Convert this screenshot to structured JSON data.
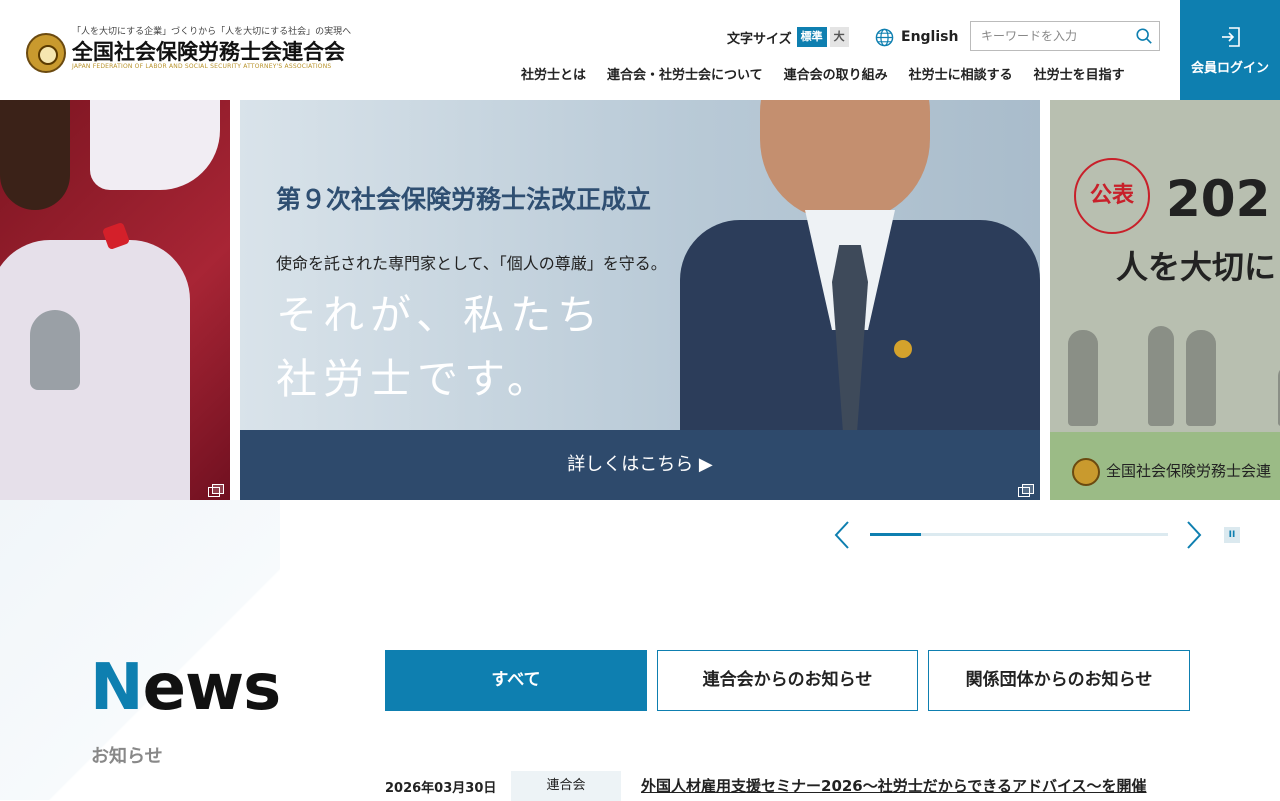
{
  "header": {
    "tagline": "「人を大切にする企業」づくりから「人を大切にする社会」の実現へ",
    "org_name": "全国社会保険労務士会連合会",
    "org_name_en": "JAPAN FEDERATION OF LABOR AND SOCIAL SECURITY ATTORNEY'S ASSOCIATIONS",
    "font_size_label": "文字サイズ",
    "font_size_standard": "標準",
    "font_size_large": "大",
    "language_label": "English",
    "search_placeholder": "キーワードを入力",
    "login_label": "会員ログイン",
    "accent_color": "#0e7fb0"
  },
  "nav": {
    "items": [
      "社労士とは",
      "連合会・社労士会について",
      "連合会の取り組み",
      "社労士に相談する",
      "社労士を目指す"
    ]
  },
  "slider": {
    "main": {
      "headline": "第９次社会保険労務士法改正成立",
      "lead": "使命を託された専門家として、「個人の尊厳」を守る。",
      "catch_line1": "それが、私たち",
      "catch_line2": "社労士です。",
      "cta": "詳しくはこちら ▶"
    },
    "right": {
      "badge": "公表",
      "year": "202",
      "subtitle": "人を大切に",
      "footer": "全国社会保険労務士会連"
    },
    "progress": 0.17
  },
  "news": {
    "title_first": "N",
    "title_rest": "ews",
    "subtitle": "お知らせ",
    "tabs": [
      "すべて",
      "連合会からのお知らせ",
      "関係団体からのお知らせ"
    ],
    "items": [
      {
        "date": "2026年03月30日",
        "category": "連合会",
        "title": "外国人材雇用支援セミナー2026〜社労士だからできるアドバイス〜を開催"
      }
    ]
  }
}
